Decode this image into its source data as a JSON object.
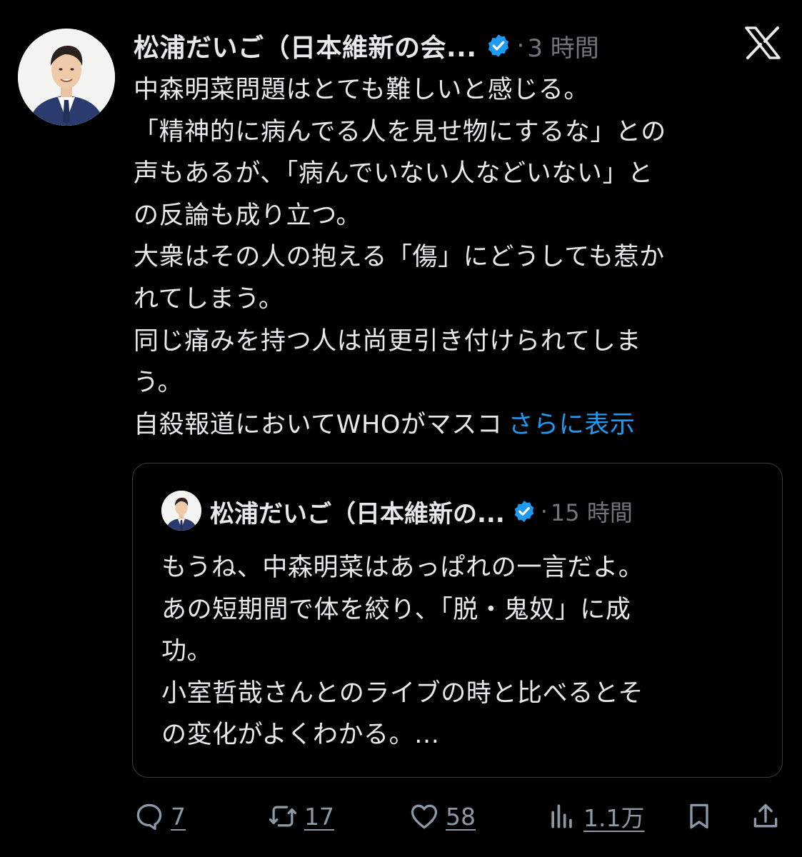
{
  "post": {
    "author_name": "松浦だいご（日本維新の会...",
    "separator": "·",
    "time": "3 時間",
    "body_lines": [
      "中森明菜問題はとても難しいと感じる。",
      "「精神的に病んでる人を見せ物にするな」との",
      "声もあるが、「病んでいない人などいない」と",
      "の反論も成り立つ。",
      "大衆はその人の抱える「傷」にどうしても惹か",
      "れてしまう。",
      "同じ痛みを持つ人は尚更引き付けられてしま",
      "う。",
      "自殺報道においてWHOがマスコ"
    ],
    "show_more": "さらに表示"
  },
  "quote": {
    "author_name": "松浦だいご（日本維新の...",
    "separator": "·",
    "time": "15 時間",
    "body_lines": [
      "もうね、中森明菜はあっぱれの一言だよ。",
      "あの短期間で体を絞り、「脱・鬼奴」に成",
      "功。",
      "小室哲哉さんとのライブの時と比べるとそ",
      "の変化がよくわかる。..."
    ]
  },
  "actions": {
    "replies": "7",
    "reposts": "17",
    "likes": "58",
    "views": "1.1万"
  },
  "icons": {
    "verified": "verified-badge-icon",
    "platform": "x-logo-icon",
    "reply": "reply-icon",
    "repost": "repost-icon",
    "like": "heart-icon",
    "views": "views-icon",
    "bookmark": "bookmark-icon",
    "share": "share-icon"
  },
  "colors": {
    "background": "#000000",
    "text": "#e7e9ea",
    "muted": "#71767b",
    "link": "#1d9bf0",
    "verified": "#1d9bf0"
  }
}
